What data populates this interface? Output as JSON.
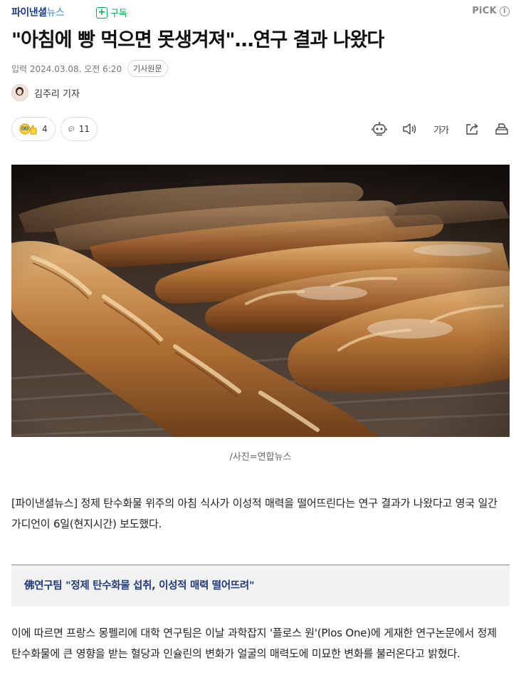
{
  "header": {
    "brand_part1": "파이낸셜",
    "brand_part2": "뉴스",
    "subscribe_label": "구독",
    "pick_label": "PiCK"
  },
  "article": {
    "title": "\"아침에 빵 먹으면 못생겨져\"…연구 결과 나왔다",
    "date_text": "입력 2024.03.08. 오전 6:20",
    "original_label": "기사원문",
    "reporter": "김주리 기자",
    "reaction_count": "4",
    "comment_count": "11",
    "photo_caption": "/사진=연합뉴스",
    "paragraph1": "[파이낸셜뉴스] 정제 탄수화물 위주의 아침 식사가 이성적 매력을 떨어뜨린다는 연구 결과가 나왔다고 영국 일간 가디언이 6일(현지시간) 보도했다.",
    "subheading": "佛연구팀 \"정제 탄수화물 섭취, 이성적 매력 떨어뜨려\"",
    "paragraph2": "이에 따르면 프랑스 몽펠리에 대학 연구팀은 이날 과학잡지 '플로스 원'(Plos One)에 게재한 연구논문에서 정제 탄수화물에 큰 영향을 받는 혈당과 인슐린의 변화가 얼굴의 매력도에 미묘한 변화를 불러온다고 밝혔다."
  },
  "tools": {
    "font_size_label": "가가"
  },
  "icons": [
    "plus-icon",
    "info-icon",
    "reaction-emoji-icon",
    "comment-icon",
    "robot-summary-icon",
    "speaker-icon",
    "font-size-icon",
    "share-icon",
    "print-icon"
  ],
  "colors": {
    "brand_dark": "#1a3e8c",
    "brand_light": "#2e8bd0",
    "subscribe_green": "#03a94f",
    "subheading_blue": "#1f3b7a"
  }
}
